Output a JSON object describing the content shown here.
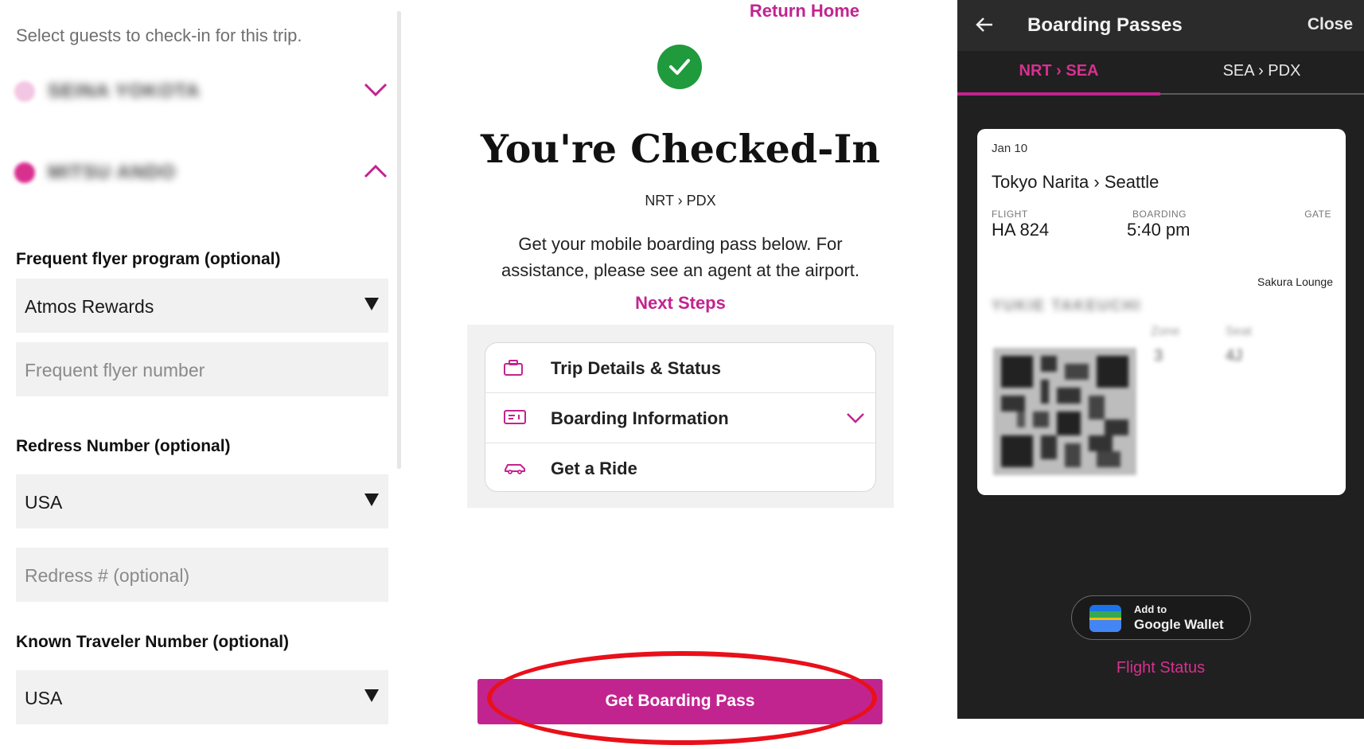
{
  "left": {
    "prompt": "Select guests to check-in for this trip.",
    "guests": [
      {
        "name": "SEINA YOKOTA",
        "dot_color": "#f3c6e3",
        "expanded": false
      },
      {
        "name": "MITSU ANDO",
        "dot_color": "#d8308f",
        "expanded": true
      }
    ],
    "frequent_flyer": {
      "label": "Frequent flyer program (optional)",
      "selected": "Atmos Rewards",
      "number_placeholder": "Frequent flyer number"
    },
    "redress": {
      "label": "Redress Number (optional)",
      "selected": "USA",
      "placeholder": "Redress # (optional)"
    },
    "known_traveler": {
      "label": "Known Traveler Number (optional)",
      "selected": "USA"
    }
  },
  "middle": {
    "return_home": "Return Home",
    "title": "You're Checked-In",
    "route": "NRT › PDX",
    "description_line1": "Get your mobile boarding pass below. For",
    "description_line2": "assistance, please see an agent at the airport.",
    "next_steps": "Next Steps",
    "steps": [
      {
        "label": "Trip Details & Status",
        "icon": "briefcase-icon"
      },
      {
        "label": "Boarding Information",
        "icon": "ticket-icon",
        "has_chevron": true
      },
      {
        "label": "Get a Ride",
        "icon": "car-icon"
      }
    ],
    "cta": "Get Boarding Pass"
  },
  "right": {
    "title": "Boarding Passes",
    "close": "Close",
    "tabs": [
      {
        "label": "NRT › SEA",
        "active": true
      },
      {
        "label": "SEA › PDX",
        "active": false
      }
    ],
    "pass": {
      "date": "Jan 10",
      "route": "Tokyo Narita › Seattle",
      "flight_label": "FLIGHT",
      "flight_value": "HA 824",
      "boarding_label": "BOARDING",
      "boarding_value": "5:40 pm",
      "gate_label": "GATE",
      "lounge": "Sakura Lounge",
      "passenger_name": "YUKIE TAKEUCHI",
      "zone_label": "Zone",
      "zone_value": "3",
      "seat_label": "Seat",
      "seat_value": "4J"
    },
    "wallet_small": "Add to",
    "wallet_big": "Google Wallet",
    "flight_status": "Flight Status"
  },
  "colors": {
    "brand_magenta": "#c2248f",
    "success_green": "#1f9a3c",
    "annotation_red": "#e8101a",
    "dark_bg": "#202020"
  }
}
